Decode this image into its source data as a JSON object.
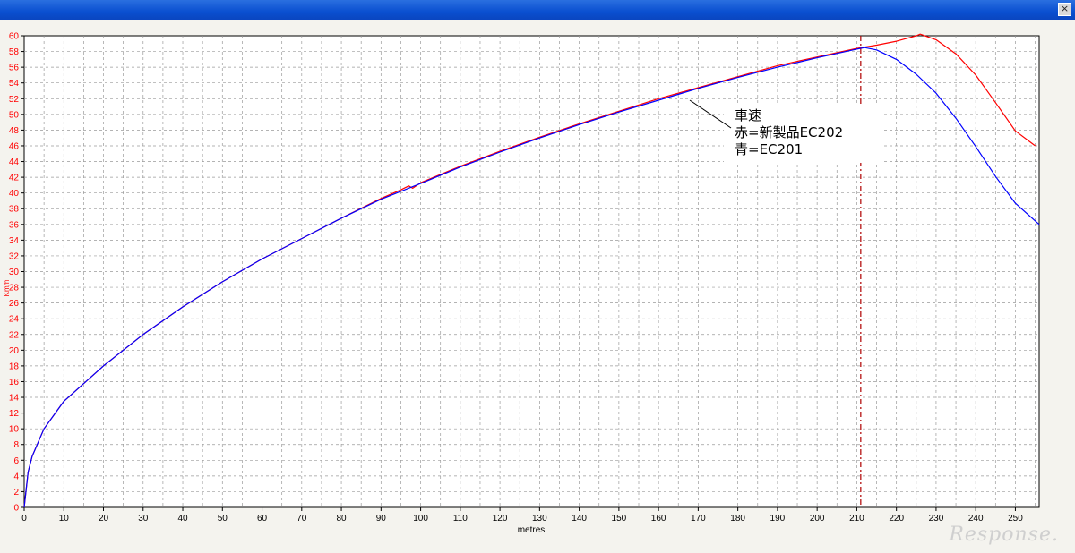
{
  "window": {
    "close_label": "×"
  },
  "watermark": "Response.",
  "colors": {
    "red": "#ff0000",
    "blue": "#0000ff",
    "grid": "#9a9a9a",
    "marker": "#b00000"
  },
  "chart_data": {
    "type": "line",
    "xlabel": "metres",
    "ylabel": "Km/h",
    "xlim": [
      0,
      256
    ],
    "ylim": [
      0,
      60
    ],
    "xticks": [
      0,
      10,
      20,
      30,
      40,
      50,
      60,
      70,
      80,
      90,
      100,
      110,
      120,
      130,
      140,
      150,
      160,
      170,
      180,
      190,
      200,
      210,
      220,
      230,
      240,
      250
    ],
    "yticks": [
      0,
      2,
      4,
      6,
      8,
      10,
      12,
      14,
      16,
      18,
      20,
      22,
      24,
      26,
      28,
      30,
      32,
      34,
      36,
      38,
      40,
      42,
      44,
      46,
      48,
      50,
      52,
      54,
      56,
      58,
      60
    ],
    "grid": true,
    "marker_x": 211,
    "annotation": [
      "車速",
      "赤=新製品EC202",
      "青=EC201"
    ],
    "series": [
      {
        "color": "red",
        "x": [
          0,
          1,
          2,
          5,
          10,
          20,
          30,
          40,
          50,
          60,
          70,
          80,
          90,
          95,
          97,
          98,
          100,
          110,
          120,
          130,
          140,
          150,
          160,
          170,
          180,
          190,
          200,
          210,
          215,
          220,
          225,
          226,
          230,
          235,
          240,
          245,
          250,
          255
        ],
        "y": [
          0,
          4.5,
          6.5,
          10,
          13.5,
          18,
          22,
          25.5,
          28.7,
          31.6,
          34.2,
          36.8,
          39.3,
          40.4,
          40.9,
          40.6,
          41.3,
          43.4,
          45.3,
          47.1,
          48.8,
          50.4,
          52,
          53.4,
          54.8,
          56.2,
          57.3,
          58.4,
          58.8,
          59.3,
          60,
          60.2,
          59.5,
          57.7,
          55,
          51.5,
          47.9,
          46
        ]
      },
      {
        "color": "blue",
        "x": [
          0,
          1,
          2,
          5,
          10,
          20,
          30,
          40,
          50,
          60,
          70,
          80,
          90,
          100,
          110,
          120,
          130,
          140,
          150,
          160,
          170,
          180,
          190,
          200,
          210,
          212,
          215,
          220,
          225,
          230,
          235,
          240,
          245,
          250,
          256
        ],
        "y": [
          0,
          4.5,
          6.5,
          10,
          13.5,
          18,
          22,
          25.5,
          28.7,
          31.6,
          34.2,
          36.8,
          39.2,
          41.2,
          43.3,
          45.2,
          47,
          48.7,
          50.3,
          51.8,
          53.3,
          54.7,
          56,
          57.2,
          58.3,
          58.5,
          58.2,
          57,
          55.1,
          52.7,
          49.5,
          45.9,
          42.1,
          38.7,
          36
        ]
      }
    ]
  }
}
